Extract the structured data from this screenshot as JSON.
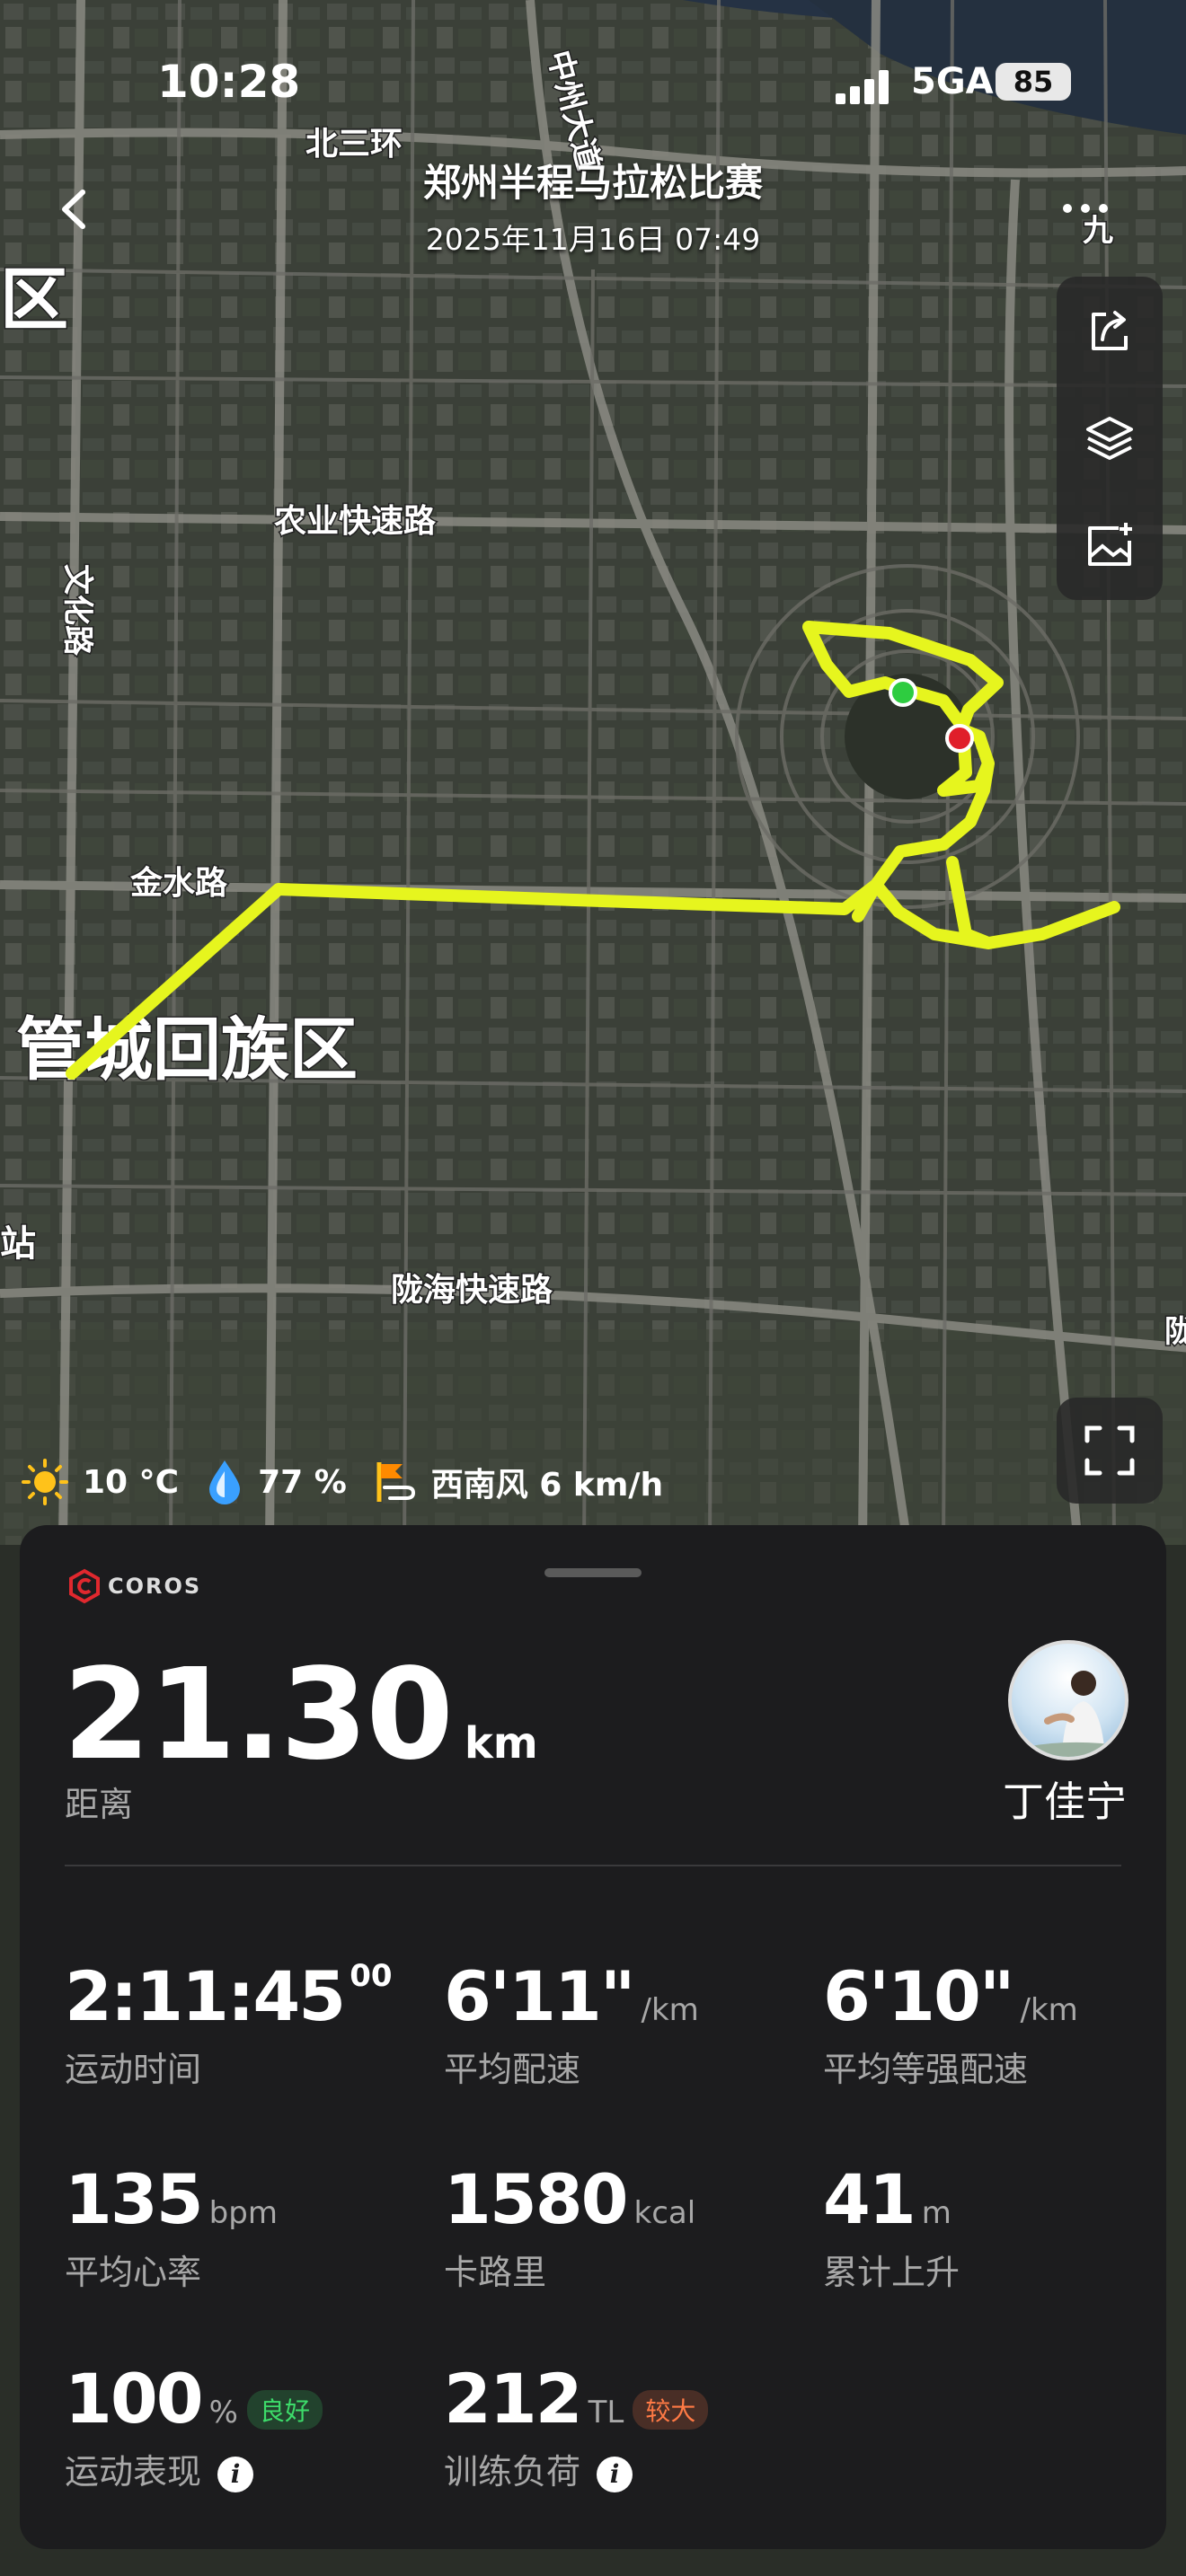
{
  "status_bar": {
    "time": "10:28",
    "network": "5GA",
    "battery": "85"
  },
  "header": {
    "title": "郑州半程马拉松比赛",
    "subtitle": "2025年11月16日 07:49"
  },
  "map": {
    "labels": [
      "北三环",
      "中州大道",
      "农业快速路",
      "文化路",
      "金水路",
      "管城回族区",
      "陇海快速路",
      "区",
      "站",
      "九",
      "陇"
    ],
    "route_color": "#e6f51e",
    "start_marker_color": "#2ecc40",
    "end_marker_color": "#e01e2a"
  },
  "toolbar": {
    "icons": [
      "share-icon",
      "layers-icon",
      "add-photo-icon"
    ]
  },
  "weather": {
    "temperature": "10 °C",
    "humidity": "77 %",
    "wind": "西南风 6 km/h"
  },
  "sheet": {
    "brand": "COROS",
    "distance": {
      "value": "21.30",
      "unit": "km",
      "label": "距离"
    },
    "user": {
      "name": "丁佳宁"
    },
    "stats": [
      {
        "value": "2:11:45",
        "sup": "00",
        "unit": "",
        "label": "运动时间"
      },
      {
        "value": "6'11\"",
        "unit": "/km",
        "label": "平均配速"
      },
      {
        "value": "6'10\"",
        "unit": "/km",
        "label": "平均等强配速"
      },
      {
        "value": "135",
        "unit": "bpm",
        "label": "平均心率"
      },
      {
        "value": "1580",
        "unit": "kcal",
        "label": "卡路里"
      },
      {
        "value": "41",
        "unit": "m",
        "label": "累计上升"
      },
      {
        "value": "100",
        "unit": "%",
        "label": "运动表现",
        "badge": "良好",
        "badge_color": "#3ddc6a"
      },
      {
        "value": "212",
        "unit": "TL",
        "label": "训练负荷",
        "badge": "较大",
        "badge_color": "#ff7a45"
      }
    ]
  }
}
